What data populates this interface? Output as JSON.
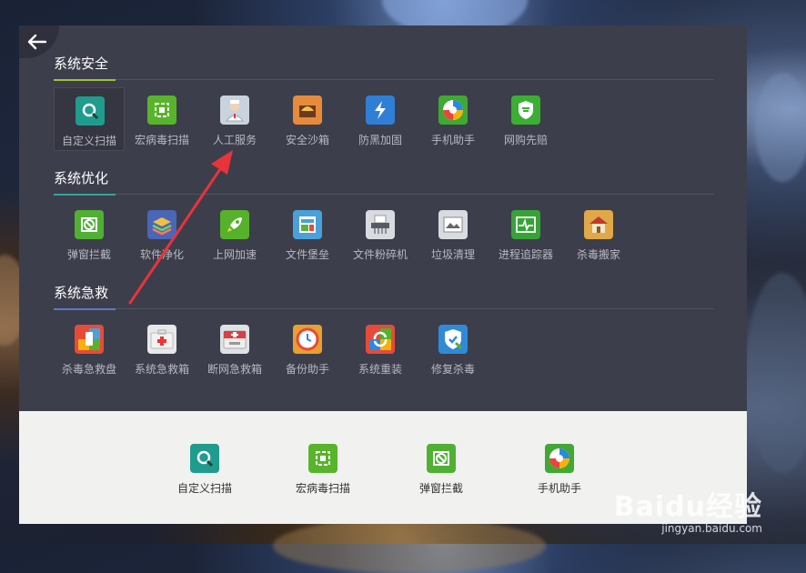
{
  "sections": [
    {
      "title": "系统安全",
      "accent": "#9bc23c",
      "items": [
        {
          "label": "自定义扫描",
          "icon": "magnifier-scan-icon",
          "color": "#1f9c8e"
        },
        {
          "label": "宏病毒扫描",
          "icon": "macro-virus-scan-icon",
          "color": "#58b42a"
        },
        {
          "label": "人工服务",
          "icon": "doctor-icon",
          "color": "#c9d3de"
        },
        {
          "label": "安全沙箱",
          "icon": "sandbox-icon",
          "color": "#e68a3c"
        },
        {
          "label": "防黑加固",
          "icon": "lightning-shield-icon",
          "color": "#2f7fd6"
        },
        {
          "label": "手机助手",
          "icon": "phone-assistant-icon",
          "color": "#41a834"
        },
        {
          "label": "网购先赔",
          "icon": "shopping-shield-icon",
          "color": "#3cae34"
        }
      ]
    },
    {
      "title": "系统优化",
      "accent": "#33a4a0",
      "items": [
        {
          "label": "弹窗拦截",
          "icon": "popup-block-icon",
          "color": "#4fb033"
        },
        {
          "label": "软件净化",
          "icon": "layers-icon",
          "color": "#4a66b8"
        },
        {
          "label": "上网加速",
          "icon": "rocket-icon",
          "color": "#56b12b"
        },
        {
          "label": "文件堡垒",
          "icon": "file-fortress-icon",
          "color": "#4aa0d8"
        },
        {
          "label": "文件粉碎机",
          "icon": "shredder-icon",
          "color": "#d8dbe0"
        },
        {
          "label": "垃圾清理",
          "icon": "trash-clean-icon",
          "color": "#d8dbe0"
        },
        {
          "label": "进程追踪器",
          "icon": "process-tracker-icon",
          "color": "#37a337"
        },
        {
          "label": "杀毒搬家",
          "icon": "move-house-icon",
          "color": "#e0a848"
        }
      ]
    },
    {
      "title": "系统急救",
      "accent": "#5a7ac8",
      "items": [
        {
          "label": "杀毒急救盘",
          "icon": "rescue-usb-icon",
          "color": "#e84a3a"
        },
        {
          "label": "系统急救箱",
          "icon": "first-aid-kit-icon",
          "color": "#e8e8ea"
        },
        {
          "label": "断网急救箱",
          "icon": "offline-aid-kit-icon",
          "color": "#dfe1e5"
        },
        {
          "label": "备份助手",
          "icon": "backup-clock-icon",
          "color": "#e8a030"
        },
        {
          "label": "系统重装",
          "icon": "reinstall-icon",
          "color": "#e84a3a"
        },
        {
          "label": "修复杀毒",
          "icon": "repair-shield-icon",
          "color": "#2f8ad8"
        }
      ]
    }
  ],
  "bottom_bar": {
    "items": [
      {
        "label": "自定义扫描",
        "icon": "magnifier-scan-icon",
        "color": "#1f9c8e"
      },
      {
        "label": "宏病毒扫描",
        "icon": "macro-virus-scan-icon",
        "color": "#58b42a"
      },
      {
        "label": "弹窗拦截",
        "icon": "popup-block-icon",
        "color": "#4fb033"
      },
      {
        "label": "手机助手",
        "icon": "phone-assistant-icon",
        "color": "#41a834"
      }
    ]
  },
  "watermark": {
    "main": "Baidu经验",
    "sub": "jingyan.baidu.com"
  },
  "annotation": {
    "arrow_color": "#e8333a"
  }
}
